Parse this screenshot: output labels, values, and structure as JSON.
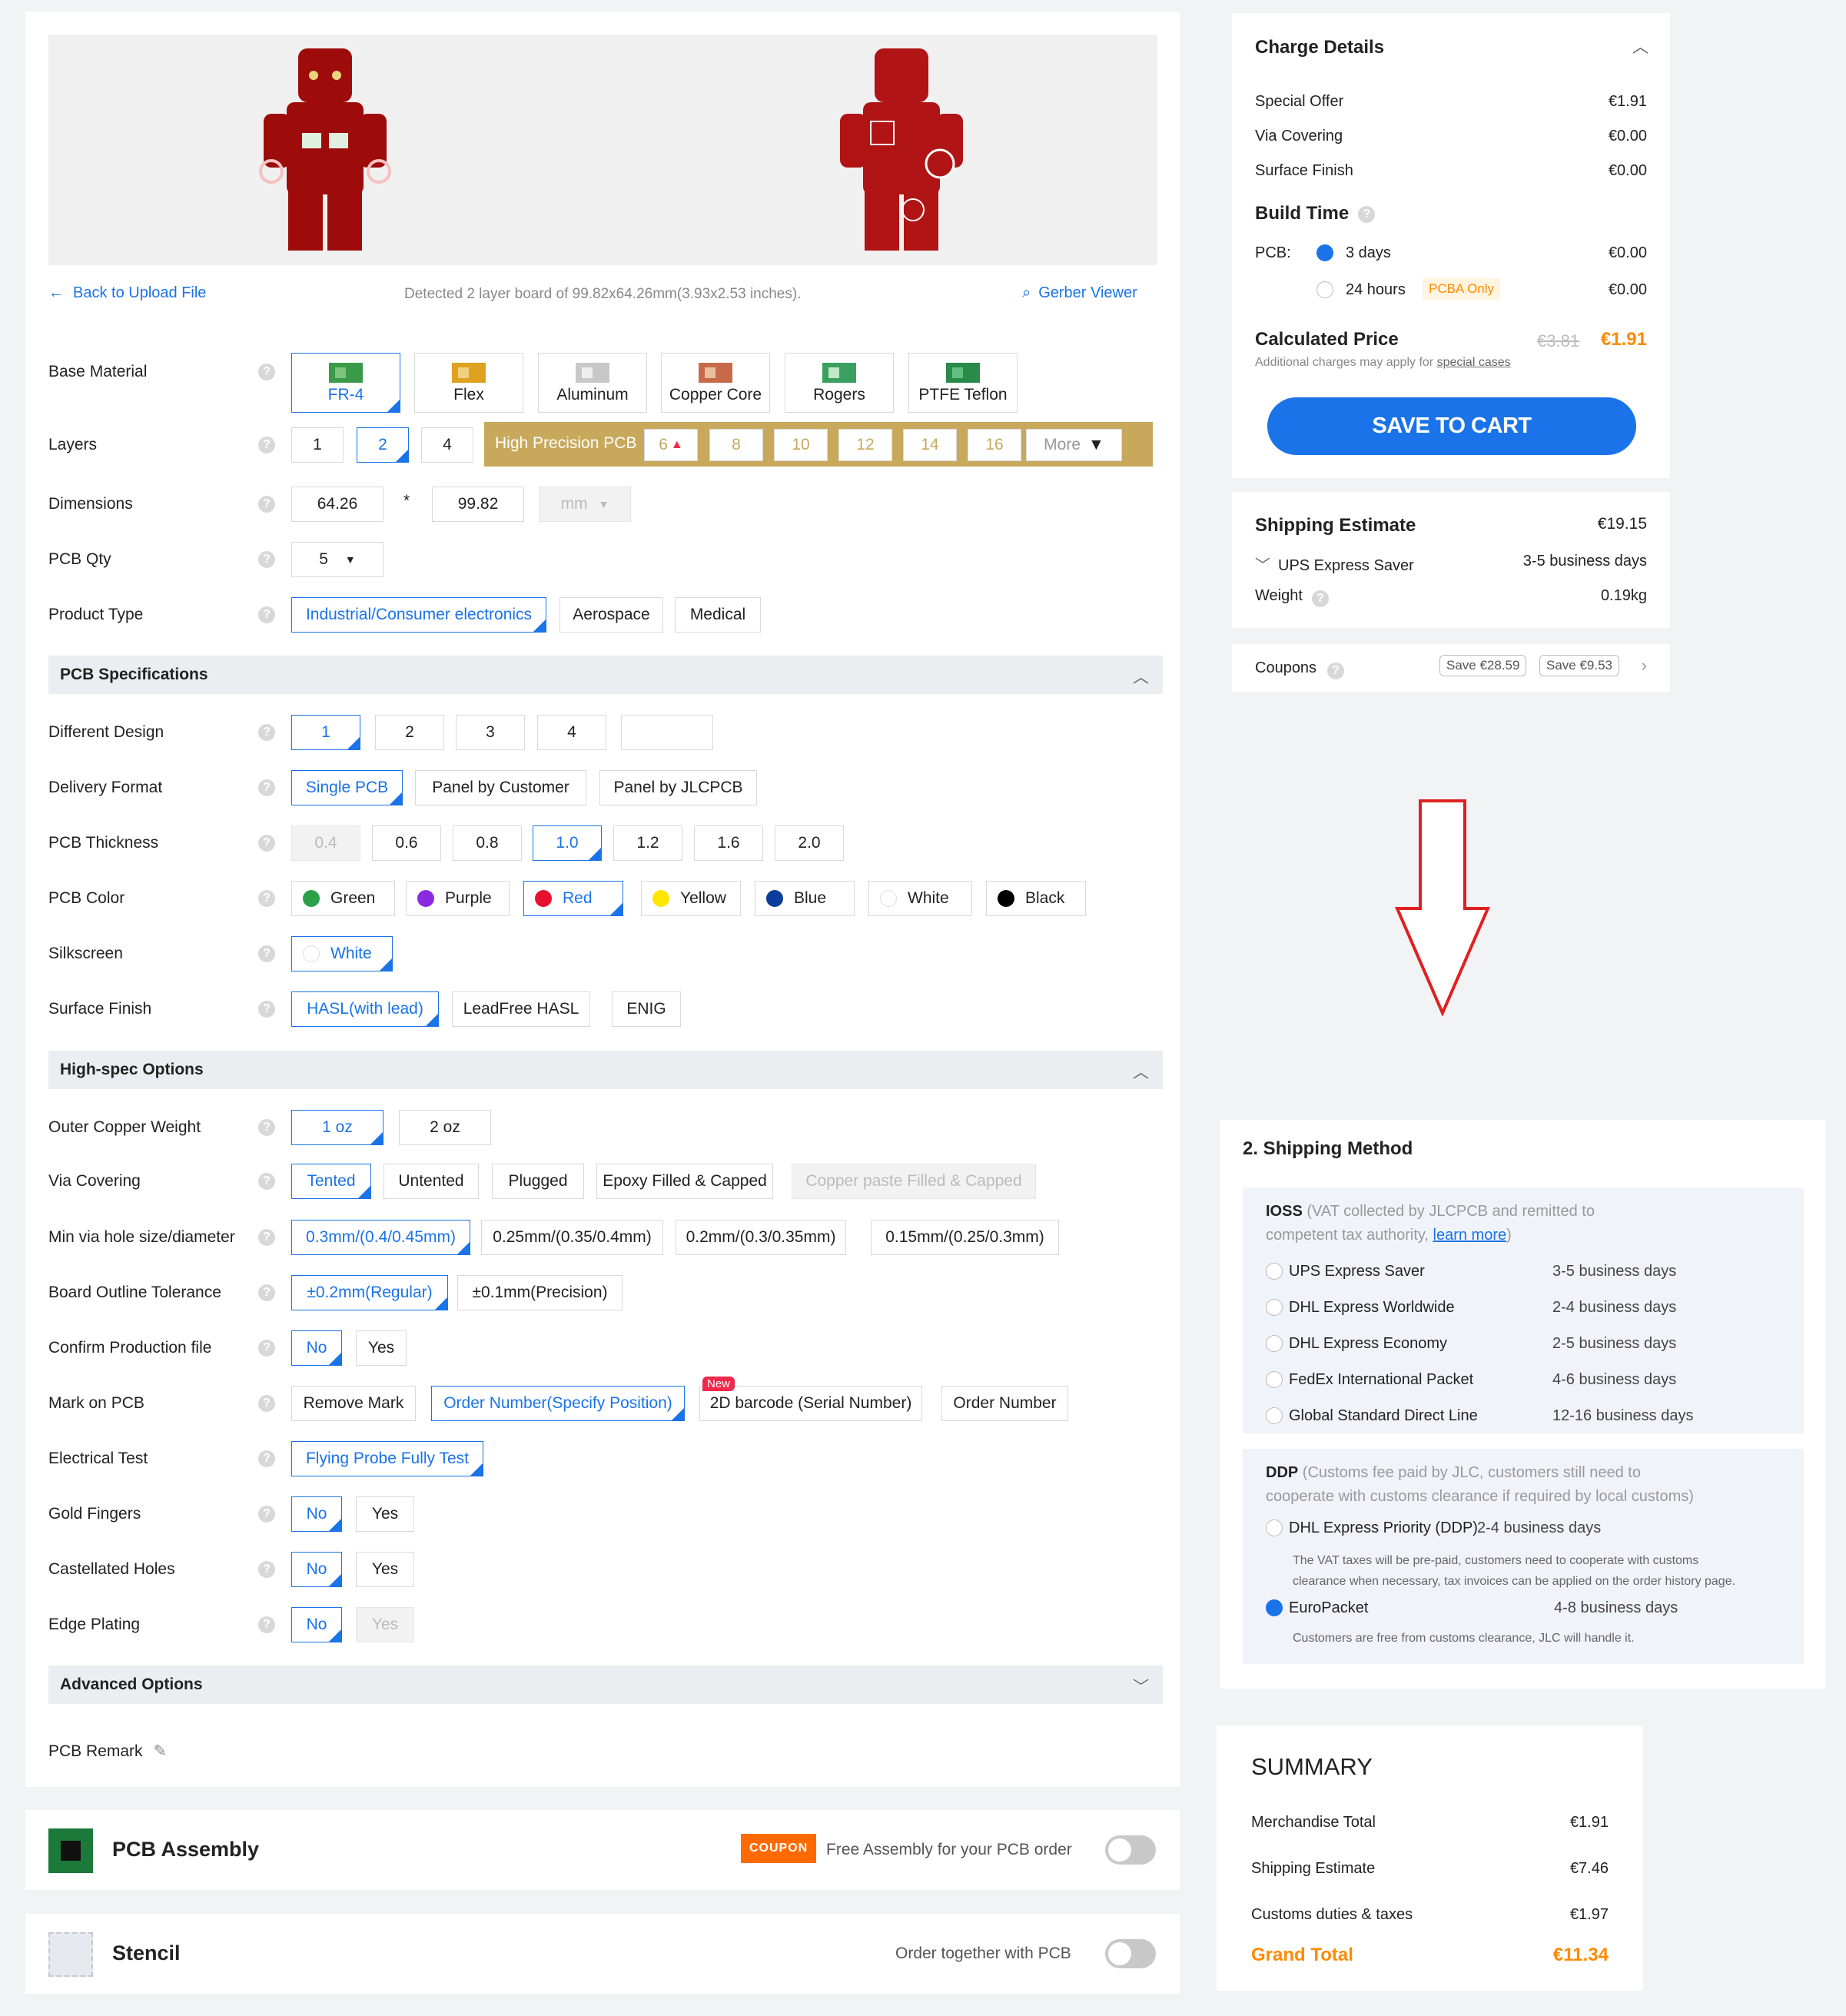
{
  "preview": {
    "detected": "Detected 2 layer board of 99.82x64.26mm(3.93x2.53 inches).",
    "back": "Back to Upload File",
    "gerber": "Gerber Viewer"
  },
  "labels": {
    "base": "Base Material",
    "layers": "Layers",
    "dims": "Dimensions",
    "qty": "PCB Qty",
    "ptype": "Product Type",
    "diff": "Different Design",
    "deliv": "Delivery Format",
    "thick": "PCB Thickness",
    "color": "PCB Color",
    "silk": "Silkscreen",
    "surface": "Surface Finish",
    "outer": "Outer Copper Weight",
    "via": "Via Covering",
    "minvia": "Min via hole size/diameter",
    "outline": "Board Outline Tolerance",
    "confirm": "Confirm Production file",
    "mark": "Mark on PCB",
    "etest": "Electrical Test",
    "gold": "Gold Fingers",
    "castel": "Castellated Holes",
    "edge": "Edge Plating",
    "remark": "PCB Remark"
  },
  "help": "?",
  "materials": [
    "FR-4",
    "Flex",
    "Aluminum",
    "Copper Core",
    "Rogers",
    "PTFE Teflon"
  ],
  "layers": {
    "opts": [
      "1",
      "2",
      "4"
    ],
    "hp": "High Precision PCB",
    "hpopts": [
      "6",
      "8",
      "10",
      "12",
      "14",
      "16"
    ],
    "more": "More"
  },
  "dims": {
    "w": "64.26",
    "sep": "*",
    "h": "99.82",
    "unit": "mm"
  },
  "qty": "5",
  "ptype": [
    "Industrial/Consumer electronics",
    "Aerospace",
    "Medical"
  ],
  "sections": {
    "spec": "PCB Specifications",
    "hispec": "High-spec Options",
    "adv": "Advanced Options"
  },
  "diff": [
    "1",
    "2",
    "3",
    "4"
  ],
  "deliv": [
    "Single PCB",
    "Panel by Customer",
    "Panel by JLCPCB"
  ],
  "thick": [
    "0.4",
    "0.6",
    "0.8",
    "1.0",
    "1.2",
    "1.6",
    "2.0"
  ],
  "colors": [
    {
      "n": "Green",
      "c": "#2aa148"
    },
    {
      "n": "Purple",
      "c": "#8a2be2"
    },
    {
      "n": "Red",
      "c": "#e8112d"
    },
    {
      "n": "Yellow",
      "c": "#ffe600"
    },
    {
      "n": "Blue",
      "c": "#0b3d9a"
    },
    {
      "n": "White",
      "c": "#ffffff"
    },
    {
      "n": "Black",
      "c": "#000000"
    }
  ],
  "silk": "White",
  "surface": [
    "HASL(with lead)",
    "LeadFree HASL",
    "ENIG"
  ],
  "outer": [
    "1 oz",
    "2 oz"
  ],
  "via": [
    "Tented",
    "Untented",
    "Plugged",
    "Epoxy Filled & Capped",
    "Copper paste Filled & Capped"
  ],
  "minvia": [
    "0.3mm/(0.4/0.45mm)",
    "0.25mm/(0.35/0.4mm)",
    "0.2mm/(0.3/0.35mm)",
    "0.15mm/(0.25/0.3mm)"
  ],
  "outline": [
    "±0.2mm(Regular)",
    "±0.1mm(Precision)"
  ],
  "yesno": [
    "No",
    "Yes"
  ],
  "mark": [
    "Remove Mark",
    "Order Number(Specify Position)",
    "2D barcode (Serial Number)",
    "Order Number"
  ],
  "newtag": "New",
  "etest": "Flying Probe Fully Test",
  "assembly": {
    "title": "PCB Assembly",
    "coupon": "COUPON",
    "text": "Free Assembly for your PCB order"
  },
  "stencil": {
    "title": "Stencil",
    "text": "Order together with PCB"
  },
  "charge": {
    "title": "Charge Details",
    "rows": [
      {
        "k": "Special Offer",
        "v": "€1.91"
      },
      {
        "k": "Via Covering",
        "v": "€0.00"
      },
      {
        "k": "Surface Finish",
        "v": "€0.00"
      }
    ],
    "build": "Build Time",
    "pcb": "PCB:",
    "d3": "3 days",
    "d3v": "€0.00",
    "h24": "24 hours",
    "pcba": "PCBA Only",
    "h24v": "€0.00",
    "calc": "Calculated Price",
    "old": "€3.81",
    "new": "€1.91",
    "add": "Additional charges may apply for ",
    "special": "special cases",
    "cart": "SAVE TO CART"
  },
  "ship": {
    "title": "Shipping Estimate",
    "price": "€19.15",
    "method": "UPS Express Saver",
    "days": "3-5 business days",
    "weight": "Weight",
    "wval": "0.19kg"
  },
  "coupons": {
    "label": "Coupons",
    "c1": "Save €28.59",
    "c2": "Save €9.53"
  },
  "method": {
    "title": "2. Shipping Method",
    "ioss": "IOSS",
    "iossnote1": "(VAT collected by JLCPCB and remitted to",
    "iossnote2": "competent tax authority, ",
    "learn": "learn more",
    "close": ")",
    "ioptions": [
      {
        "n": "UPS Express Saver",
        "d": "3-5 business days"
      },
      {
        "n": "DHL Express Worldwide",
        "d": "2-4 business days"
      },
      {
        "n": "DHL Express Economy",
        "d": "2-5 business days"
      },
      {
        "n": "FedEx International Packet",
        "d": "4-6 business days"
      },
      {
        "n": "Global Standard Direct Line",
        "d": "12-16 business days"
      }
    ],
    "ddp": "DDP",
    "ddpnote1": "(Customs fee paid by JLC, customers still need to",
    "ddpnote2": "cooperate with customs clearance if required by local customs)",
    "dhlp": "DHL Express Priority (DDP)",
    "dhlpd": "2-4 business days",
    "dhlpnote1": "The VAT taxes will be pre-paid, customers need to cooperate with customs",
    "dhlpnote2": "clearance when necessary, tax invoices can be applied on the order history page.",
    "euro": "EuroPacket",
    "eurod": "4-8 business days",
    "euronote": "Customers are free from customs clearance, JLC will handle it."
  },
  "summary": {
    "title": "SUMMARY",
    "rows": [
      {
        "k": "Merchandise Total",
        "v": "€1.91"
      },
      {
        "k": "Shipping Estimate",
        "v": "€7.46"
      },
      {
        "k": "Customs duties & taxes",
        "v": "€1.97"
      }
    ],
    "grand": "Grand Total",
    "grandv": "€11.34"
  },
  "accent": "#1a73e8",
  "arrow_color": "#e02020",
  "grand_color": "#ff8a00"
}
